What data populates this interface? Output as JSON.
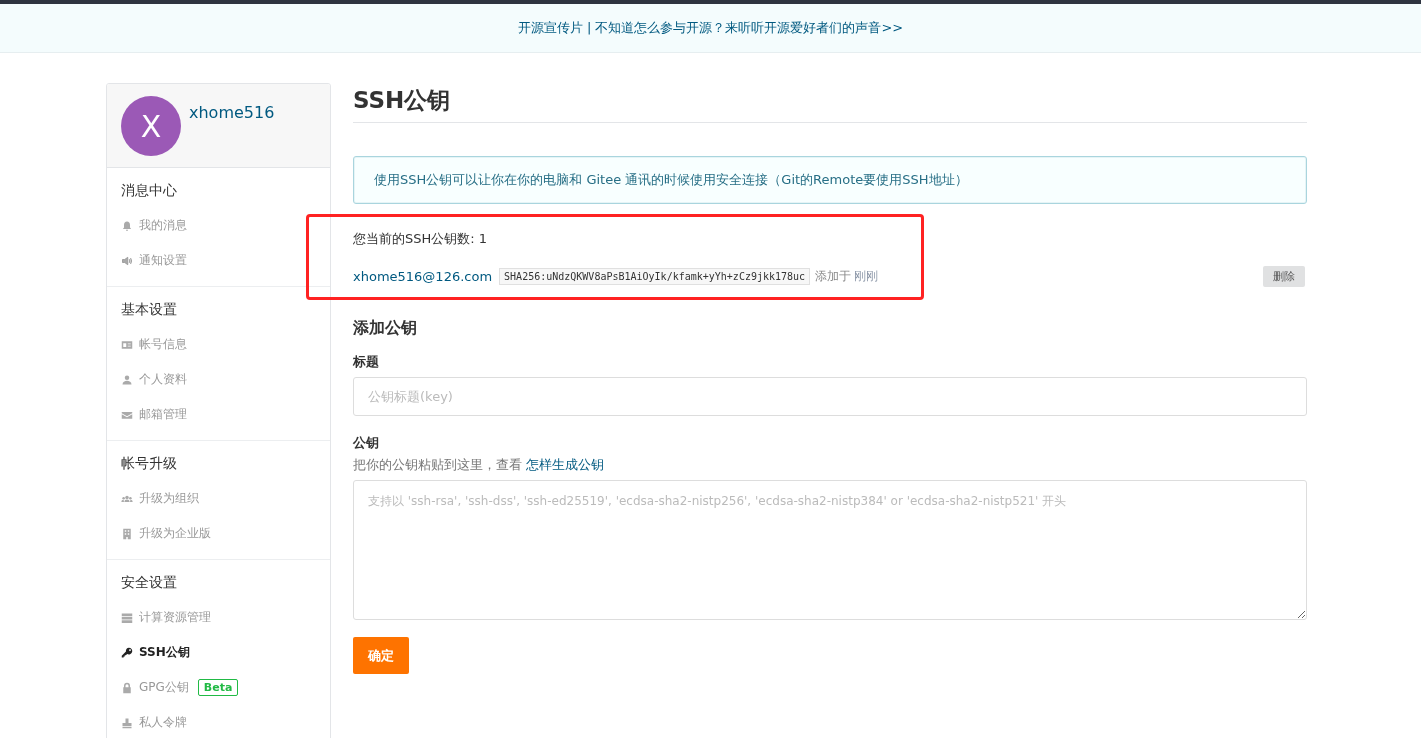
{
  "banner": {
    "text": "开源宣传片 | 不知道怎么参与开源？来听听开源爱好者们的声音>>"
  },
  "profile": {
    "avatar_letter": "X",
    "username": "xhome516"
  },
  "sidebar": {
    "groups": [
      {
        "title": "消息中心",
        "items": [
          {
            "kind": "bell",
            "label": "我的消息",
            "selected": false
          },
          {
            "kind": "speaker",
            "label": "通知设置",
            "selected": false
          }
        ]
      },
      {
        "title": "基本设置",
        "items": [
          {
            "kind": "card",
            "label": "帐号信息",
            "selected": false
          },
          {
            "kind": "person",
            "label": "个人资料",
            "selected": false
          },
          {
            "kind": "mail",
            "label": "邮箱管理",
            "selected": false
          }
        ]
      },
      {
        "title": "帐号升级",
        "items": [
          {
            "kind": "users",
            "label": "升级为组织",
            "selected": false
          },
          {
            "kind": "building",
            "label": "升级为企业版",
            "selected": false
          }
        ]
      },
      {
        "title": "安全设置",
        "items": [
          {
            "kind": "server",
            "label": "计算资源管理",
            "selected": false
          },
          {
            "kind": "key",
            "label": "SSH公钥",
            "selected": true
          },
          {
            "kind": "lock",
            "label": "GPG公钥",
            "badge": "Beta",
            "selected": false
          },
          {
            "kind": "stamp",
            "label": "私人令牌",
            "selected": false
          }
        ]
      }
    ]
  },
  "page_title": "SSH公钥",
  "info": "使用SSH公钥可以让你在你的电脑和 Gitee 通讯的时候使用安全连接（Git的Remote要使用SSH地址）",
  "keys": {
    "highlighted": true,
    "count_text": "您当前的SSH公钥数: 1",
    "items": [
      {
        "title": "xhome516@126.com",
        "fingerprint": "SHA256:uNdzQKWV8aPsB1AiOyIk/kfamk+yYh+zCz9jkk178uc",
        "added_label": "添加于",
        "added_time": "刚刚",
        "delete": "删除"
      }
    ]
  },
  "add_form": {
    "heading": "添加公钥",
    "title_label": "标题",
    "title_placeholder": "公钥标题(key)",
    "key_label": "公钥",
    "key_hint": "把你的公钥粘贴到这里，查看",
    "key_hint_link": "怎样生成公钥",
    "key_placeholder": "支持以 'ssh-rsa', 'ssh-dss', 'ssh-ed25519', 'ecdsa-sha2-nistp256', 'ecdsa-sha2-nistp384' or 'ecdsa-sha2-nistp521' 开头",
    "submit": "确定"
  }
}
